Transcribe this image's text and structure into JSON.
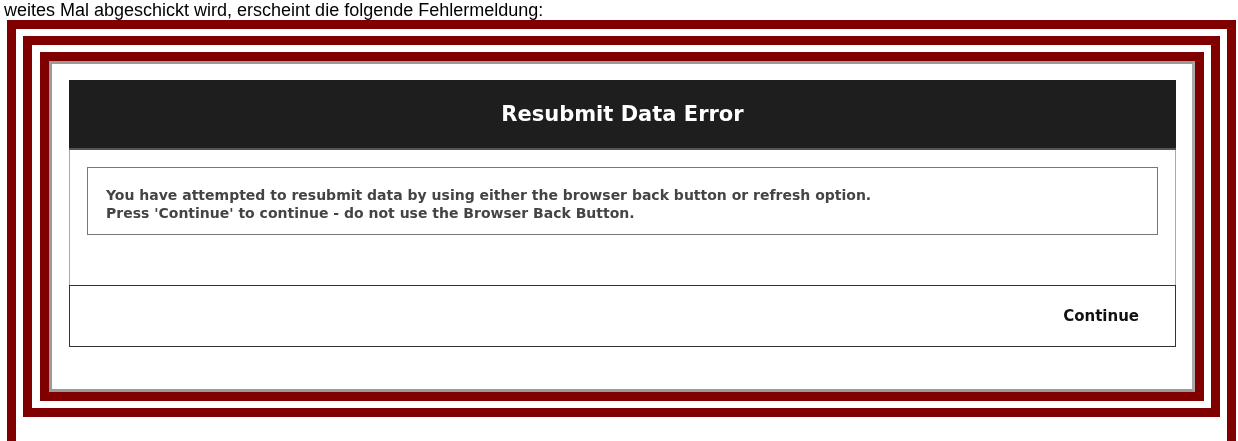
{
  "caption": "weites Mal abgeschickt wird, erscheint die folgende Fehlermeldung:",
  "dialog": {
    "title": "Resubmit Data Error",
    "message_lines": [
      "You have attempted to resubmit data by using either the browser back button or refresh option.",
      "Press 'Continue' to continue - do not use the Browser Back Button."
    ],
    "button": "Continue"
  }
}
